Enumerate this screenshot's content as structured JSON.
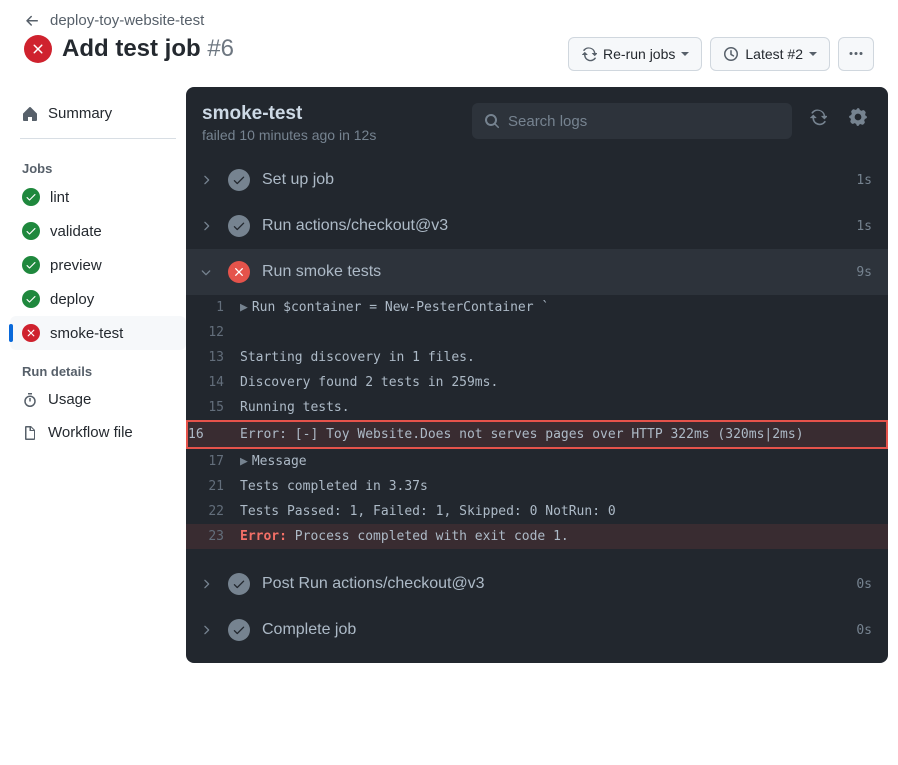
{
  "breadcrumb": "deploy-toy-website-test",
  "run_title": "Add test job",
  "run_number": "#6",
  "buttons": {
    "rerun": "Re-run jobs",
    "latest": "Latest #2"
  },
  "sidebar": {
    "summary": "Summary",
    "jobs_heading": "Jobs",
    "jobs": [
      {
        "label": "lint",
        "status": "ok"
      },
      {
        "label": "validate",
        "status": "ok"
      },
      {
        "label": "preview",
        "status": "ok"
      },
      {
        "label": "deploy",
        "status": "ok"
      },
      {
        "label": "smoke-test",
        "status": "fail"
      }
    ],
    "details_heading": "Run details",
    "usage": "Usage",
    "workflow_file": "Workflow file"
  },
  "log": {
    "job_name": "smoke-test",
    "job_status_line": "failed 10 minutes ago in 12s",
    "search_placeholder": "Search logs",
    "steps": [
      {
        "title": "Set up job",
        "dur": "1s",
        "status": "ok",
        "expanded": false
      },
      {
        "title": "Run actions/checkout@v3",
        "dur": "1s",
        "status": "ok",
        "expanded": false
      },
      {
        "title": "Run smoke tests",
        "dur": "9s",
        "status": "fail",
        "expanded": true
      },
      {
        "title": "Post Run actions/checkout@v3",
        "dur": "0s",
        "status": "ok",
        "expanded": false
      },
      {
        "title": "Complete job",
        "dur": "0s",
        "status": "ok",
        "expanded": false
      }
    ],
    "lines": {
      "l1": "Run $container = New-PesterContainer `",
      "l13": "Starting discovery in 1 files.",
      "l14": "Discovery found 2 tests in 259ms.",
      "l15": "Running tests.",
      "l16_err": "Error:",
      "l16_rest": " [-] Toy Website.Does not serves pages over HTTP 322ms (320ms|2ms)",
      "l17": "Message",
      "l21": "Tests completed in 3.37s",
      "l22": "Tests Passed: 1, Failed: 1, Skipped: 0 NotRun: 0",
      "l23_err": "Error:",
      "l23_rest": " Process completed with exit code 1."
    }
  }
}
